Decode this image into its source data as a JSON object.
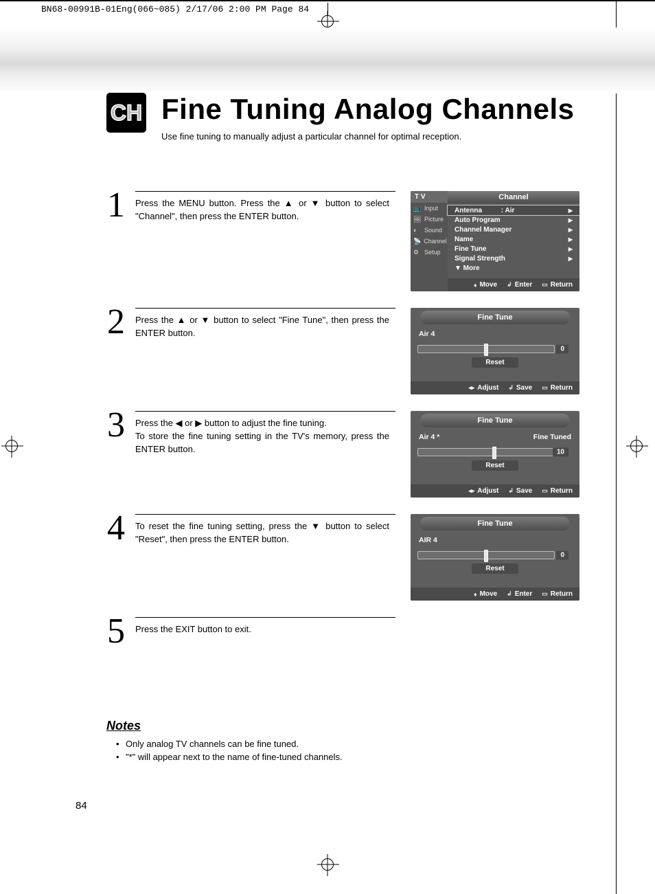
{
  "crop": {
    "header": "BN68-00991B-01Eng(066~085)  2/17/06  2:00 PM  Page 84"
  },
  "badge": "CH",
  "title": "Fine Tuning Analog Channels",
  "subtitle": "Use fine tuning to manually adjust a particular channel for optimal reception.",
  "steps": {
    "s1": {
      "num": "1",
      "text": "Press the MENU button. Press the ▲ or ▼ button to select \"Channel\", then press the ENTER button."
    },
    "s2": {
      "num": "2",
      "text": "Press the ▲ or ▼ button to select \"Fine Tune\", then press the ENTER button."
    },
    "s3": {
      "num": "3",
      "text": "Press the ◀ or ▶ button to adjust the fine tuning.\nTo store the fine tuning setting in the TV's memory, press the ENTER button."
    },
    "s4": {
      "num": "4",
      "text": "To reset the fine tuning setting, press the ▼ button to select \"Reset\", then press the ENTER button."
    },
    "s5": {
      "num": "5",
      "text": "Press the EXIT button to exit."
    }
  },
  "osd1": {
    "tv": "T V",
    "sideItems": [
      "Input",
      "Picture",
      "Sound",
      "Channel",
      "Setup"
    ],
    "mtitle": "Channel",
    "rows": [
      {
        "label": "Antenna",
        "value": ": Air",
        "hl": true
      },
      {
        "label": "Auto Program",
        "value": ""
      },
      {
        "label": "Channel Manager",
        "value": ""
      },
      {
        "label": "Name",
        "value": ""
      },
      {
        "label": "Fine Tune",
        "value": ""
      },
      {
        "label": "Signal Strength",
        "value": ""
      },
      {
        "label": "▼ More",
        "value": "",
        "noarrow": true
      }
    ],
    "bottom": {
      "move": "Move",
      "enter": "Enter",
      "ret": "Return"
    }
  },
  "osd_ft": {
    "title": "Fine Tune",
    "reset": "Reset",
    "bottomA": {
      "l": "Adjust",
      "c": "Save",
      "r": "Return"
    },
    "bottomB": {
      "l": "Move",
      "c": "Enter",
      "r": "Return"
    }
  },
  "ft2": {
    "ch": "Air  4",
    "status": "",
    "val": "0",
    "thumb": "50%"
  },
  "ft3": {
    "ch": "Air  4 *",
    "status": "Fine Tuned",
    "val": "10",
    "thumb": "56%"
  },
  "ft4": {
    "ch": "AIR  4",
    "status": "",
    "val": "0",
    "thumb": "50%"
  },
  "notes": {
    "heading": "Notes",
    "items": [
      "Only analog TV channels can be fine tuned.",
      "\"*\" will appear next to the name of fine-tuned channels."
    ]
  },
  "page_no": "84"
}
